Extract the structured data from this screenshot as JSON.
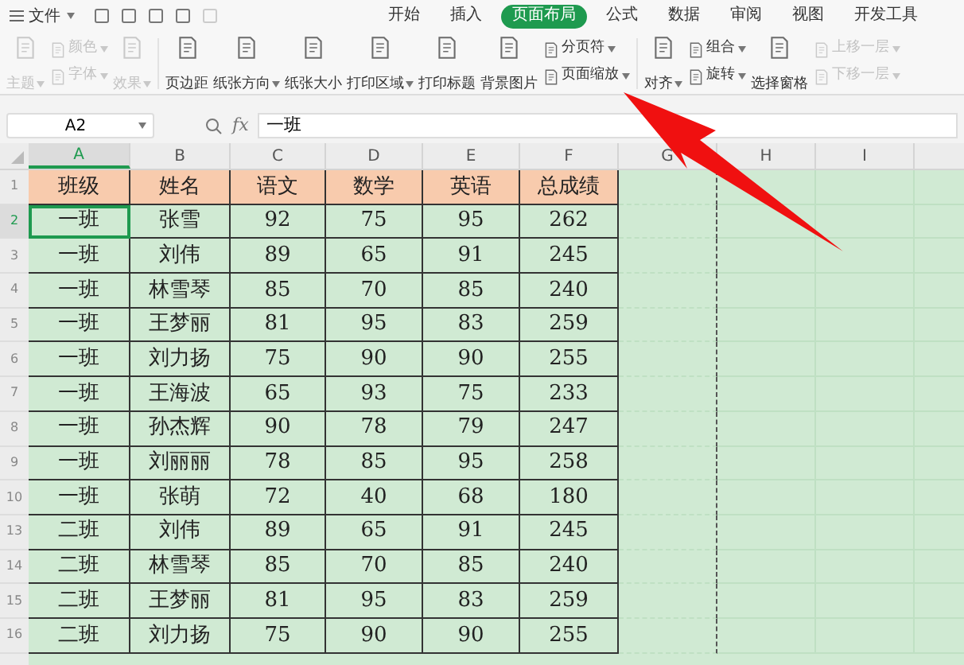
{
  "menu": {
    "label": "文件"
  },
  "tabs": [
    {
      "label": "开始",
      "selected": false
    },
    {
      "label": "插入",
      "selected": false
    },
    {
      "label": "页面布局",
      "selected": true
    },
    {
      "label": "公式",
      "selected": false
    },
    {
      "label": "数据",
      "selected": false
    },
    {
      "label": "审阅",
      "selected": false
    },
    {
      "label": "视图",
      "selected": false
    },
    {
      "label": "开发工具",
      "selected": false
    }
  ],
  "ribbon": [
    {
      "kind": "large",
      "label": "主题",
      "dropdown": true,
      "disabled": true
    },
    {
      "kind": "stack",
      "items": [
        {
          "label": "颜色",
          "dropdown": true,
          "disabled": true
        },
        {
          "label": "字体",
          "dropdown": true,
          "disabled": true
        }
      ]
    },
    {
      "kind": "large",
      "label": "效果",
      "dropdown": true,
      "disabled": true
    },
    {
      "kind": "separator"
    },
    {
      "kind": "large",
      "label": "页边距",
      "dropdown": false,
      "disabled": false
    },
    {
      "kind": "large",
      "label": "纸张方向",
      "dropdown": true,
      "disabled": false
    },
    {
      "kind": "large",
      "label": "纸张大小",
      "dropdown": false,
      "disabled": false
    },
    {
      "kind": "large",
      "label": "打印区域",
      "dropdown": true,
      "disabled": false
    },
    {
      "kind": "large",
      "label": "打印标题",
      "dropdown": false,
      "disabled": false
    },
    {
      "kind": "large",
      "label": "背景图片",
      "dropdown": false,
      "disabled": false
    },
    {
      "kind": "stack",
      "items": [
        {
          "label": "分页符",
          "dropdown": true,
          "disabled": false
        },
        {
          "label": "页面缩放",
          "dropdown": true,
          "disabled": false
        }
      ]
    },
    {
      "kind": "separator"
    },
    {
      "kind": "large",
      "label": "对齐",
      "dropdown": true,
      "disabled": false
    },
    {
      "kind": "stack",
      "items": [
        {
          "label": "组合",
          "dropdown": true,
          "disabled": false
        },
        {
          "label": "旋转",
          "dropdown": true,
          "disabled": false
        }
      ]
    },
    {
      "kind": "large",
      "label": "选择窗格",
      "dropdown": false,
      "disabled": false
    },
    {
      "kind": "stack",
      "items": [
        {
          "label": "上移一层",
          "dropdown": true,
          "disabled": true
        },
        {
          "label": "下移一层",
          "dropdown": true,
          "disabled": true
        }
      ]
    }
  ],
  "formula_bar": {
    "name_box": "A2",
    "function_label": "fx",
    "value": "一班"
  },
  "columns": [
    {
      "label": "A",
      "selected": true
    },
    {
      "label": "B",
      "selected": false
    },
    {
      "label": "C",
      "selected": false
    },
    {
      "label": "D",
      "selected": false
    },
    {
      "label": "E",
      "selected": false
    },
    {
      "label": "F",
      "selected": false
    },
    {
      "label": "G",
      "selected": false
    },
    {
      "label": "H",
      "selected": false
    },
    {
      "label": "I",
      "selected": false
    }
  ],
  "rows": [
    {
      "number": "1",
      "kind": "header",
      "selected": false,
      "cells": [
        "班级",
        "姓名",
        "语文",
        "数学",
        "英语",
        "总成绩"
      ]
    },
    {
      "number": "2",
      "kind": "data",
      "selected": true,
      "cells": [
        "一班",
        "张雪",
        "92",
        "75",
        "95",
        "262"
      ]
    },
    {
      "number": "3",
      "kind": "data",
      "selected": false,
      "cells": [
        "一班",
        "刘伟",
        "89",
        "65",
        "91",
        "245"
      ]
    },
    {
      "number": "4",
      "kind": "data",
      "selected": false,
      "cells": [
        "一班",
        "林雪琴",
        "85",
        "70",
        "85",
        "240"
      ]
    },
    {
      "number": "5",
      "kind": "data",
      "selected": false,
      "cells": [
        "一班",
        "王梦丽",
        "81",
        "95",
        "83",
        "259"
      ]
    },
    {
      "number": "6",
      "kind": "data",
      "selected": false,
      "cells": [
        "一班",
        "刘力扬",
        "75",
        "90",
        "90",
        "255"
      ]
    },
    {
      "number": "7",
      "kind": "data",
      "selected": false,
      "cells": [
        "一班",
        "王海波",
        "65",
        "93",
        "75",
        "233"
      ]
    },
    {
      "number": "8",
      "kind": "data",
      "selected": false,
      "cells": [
        "一班",
        "孙杰辉",
        "90",
        "78",
        "79",
        "247"
      ]
    },
    {
      "number": "9",
      "kind": "data",
      "selected": false,
      "cells": [
        "一班",
        "刘丽丽",
        "78",
        "85",
        "95",
        "258"
      ]
    },
    {
      "number": "10",
      "kind": "data",
      "selected": false,
      "cells": [
        "一班",
        "张萌",
        "72",
        "40",
        "68",
        "180"
      ]
    },
    {
      "number": "13",
      "kind": "data",
      "selected": false,
      "cells": [
        "二班",
        "刘伟",
        "89",
        "65",
        "91",
        "245"
      ]
    },
    {
      "number": "14",
      "kind": "data",
      "selected": false,
      "cells": [
        "二班",
        "林雪琴",
        "85",
        "70",
        "85",
        "240"
      ]
    },
    {
      "number": "15",
      "kind": "data",
      "selected": false,
      "cells": [
        "二班",
        "王梦丽",
        "81",
        "95",
        "83",
        "259"
      ]
    },
    {
      "number": "16",
      "kind": "data",
      "selected": false,
      "cells": [
        "二班",
        "刘力扬",
        "75",
        "90",
        "90",
        "255"
      ]
    }
  ]
}
